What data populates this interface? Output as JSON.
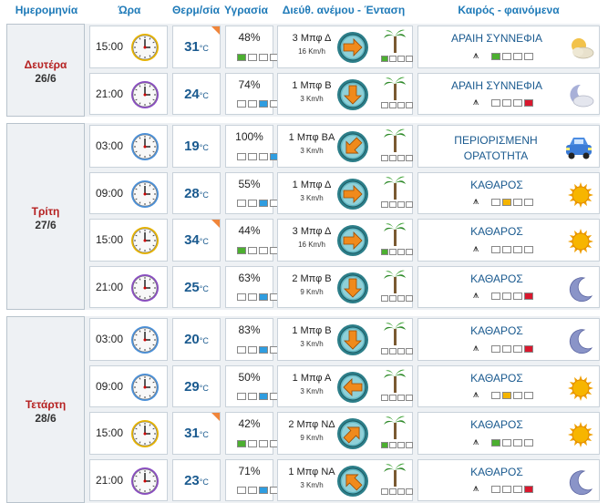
{
  "header": {
    "date": "Ημερομηνία",
    "hour": "Ώρα",
    "temp": "Θερμ/σία",
    "humidity": "Υγρασία",
    "wind": "Διεύθ. ανέμου - Ένταση",
    "weather": "Καιρός - φαινόμενα"
  },
  "temp_unit": "°C",
  "days": [
    {
      "name": "Δευτέρα",
      "date": "26/6",
      "rows": [
        {
          "time": "15:00",
          "clock": "yellow",
          "temp": "31",
          "hot": true,
          "hum": "48%",
          "hum_level": 1,
          "hum_color": "green",
          "wind": "3 Μπφ Δ",
          "speed": "16 Km/h",
          "dir": "E",
          "wind_level": 1,
          "cond": "ΑΡΑΙΗ ΣΥΝΝΕΦΙΑ",
          "cond_level": 1,
          "cond_color": "green",
          "icon": "sun-cloud-icon"
        },
        {
          "time": "21:00",
          "clock": "purple",
          "temp": "24",
          "hot": false,
          "hum": "74%",
          "hum_level": 3,
          "hum_color": "blue",
          "wind": "1 Μπφ Β",
          "speed": "3 Km/h",
          "dir": "S",
          "wind_level": 0,
          "cond": "ΑΡΑΙΗ ΣΥΝΝΕΦΙΑ",
          "cond_level": 4,
          "cond_color": "red",
          "icon": "moon-cloud-icon"
        }
      ]
    },
    {
      "name": "Τρίτη",
      "date": "27/6",
      "rows": [
        {
          "time": "03:00",
          "clock": "blue",
          "temp": "19",
          "hot": false,
          "hum": "100%",
          "hum_level": 4,
          "hum_color": "blue",
          "wind": "1 Μπφ ΒΑ",
          "speed": "3 Km/h",
          "dir": "SW",
          "wind_level": 0,
          "cond": "ΠΕΡΙΟΡΙΣΜΕΝΗ ΟΡΑΤΟΤΗΤΑ",
          "cond_level": 0,
          "cond_color": "none",
          "icon": "car-fog-icon"
        },
        {
          "time": "09:00",
          "clock": "blue",
          "temp": "28",
          "hot": false,
          "hum": "55%",
          "hum_level": 3,
          "hum_color": "blue",
          "wind": "1 Μπφ Δ",
          "speed": "3 Km/h",
          "dir": "E",
          "wind_level": 0,
          "cond": "ΚΑΘΑΡΟΣ",
          "cond_level": 2,
          "cond_color": "yellow",
          "icon": "sun-icon"
        },
        {
          "time": "15:00",
          "clock": "yellow",
          "temp": "34",
          "hot": true,
          "hum": "44%",
          "hum_level": 1,
          "hum_color": "green",
          "wind": "3 Μπφ Δ",
          "speed": "16 Km/h",
          "dir": "E",
          "wind_level": 1,
          "cond": "ΚΑΘΑΡΟΣ",
          "cond_level": 0,
          "cond_color": "none",
          "icon": "sun-icon"
        },
        {
          "time": "21:00",
          "clock": "purple",
          "temp": "25",
          "hot": false,
          "hum": "63%",
          "hum_level": 3,
          "hum_color": "blue",
          "wind": "2 Μπφ Β",
          "speed": "9 Km/h",
          "dir": "S",
          "wind_level": 0,
          "cond": "ΚΑΘΑΡΟΣ",
          "cond_level": 4,
          "cond_color": "red",
          "icon": "moon-icon"
        }
      ]
    },
    {
      "name": "Τετάρτη",
      "date": "28/6",
      "rows": [
        {
          "time": "03:00",
          "clock": "blue",
          "temp": "20",
          "hot": false,
          "hum": "83%",
          "hum_level": 3,
          "hum_color": "blue",
          "wind": "1 Μπφ Β",
          "speed": "3 Km/h",
          "dir": "S",
          "wind_level": 0,
          "cond": "ΚΑΘΑΡΟΣ",
          "cond_level": 4,
          "cond_color": "red",
          "icon": "moon-icon"
        },
        {
          "time": "09:00",
          "clock": "blue",
          "temp": "29",
          "hot": false,
          "hum": "50%",
          "hum_level": 3,
          "hum_color": "blue",
          "wind": "1 Μπφ Α",
          "speed": "3 Km/h",
          "dir": "W",
          "wind_level": 0,
          "cond": "ΚΑΘΑΡΟΣ",
          "cond_level": 2,
          "cond_color": "yellow",
          "icon": "sun-icon"
        },
        {
          "time": "15:00",
          "clock": "yellow",
          "temp": "31",
          "hot": true,
          "hum": "42%",
          "hum_level": 1,
          "hum_color": "green",
          "wind": "2 Μπφ ΝΔ",
          "speed": "9 Km/h",
          "dir": "NE",
          "wind_level": 1,
          "cond": "ΚΑΘΑΡΟΣ",
          "cond_level": 1,
          "cond_color": "green",
          "icon": "sun-icon"
        },
        {
          "time": "21:00",
          "clock": "purple",
          "temp": "23",
          "hot": false,
          "hum": "71%",
          "hum_level": 3,
          "hum_color": "blue",
          "wind": "1 Μπφ ΝΑ",
          "speed": "3 Km/h",
          "dir": "NW",
          "wind_level": 0,
          "cond": "ΚΑΘΑΡΟΣ",
          "cond_level": 4,
          "cond_color": "red",
          "icon": "moon-icon"
        }
      ]
    }
  ],
  "colors": {
    "green": "#4caf30",
    "blue": "#2f9de0",
    "yellow": "#f4b400",
    "red": "#d9182e",
    "hot": "#f0853a"
  }
}
